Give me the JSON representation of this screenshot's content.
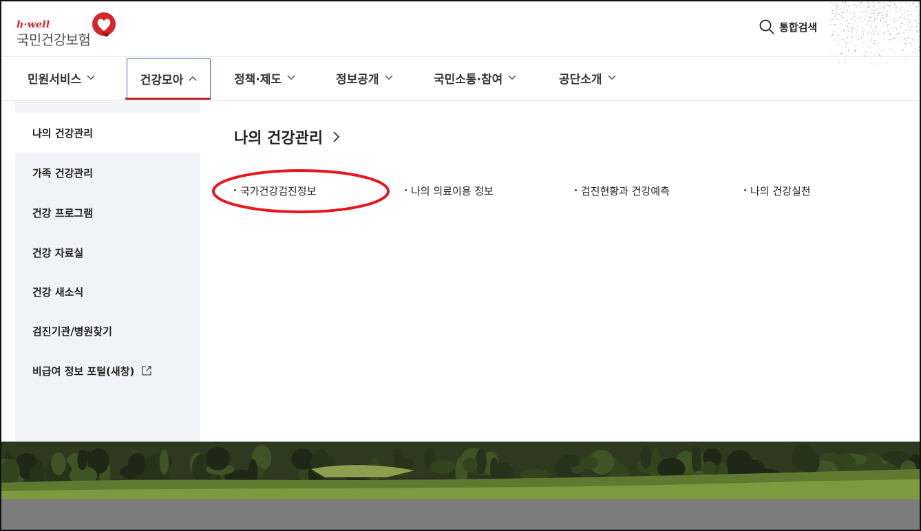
{
  "header": {
    "logo_brand": "h·well",
    "logo_name": "국민건강보험",
    "search_label": "통합검색"
  },
  "gnb": {
    "items": [
      {
        "label": "민원서비스",
        "expanded": false
      },
      {
        "label": "건강모아",
        "expanded": true
      },
      {
        "label": "정책·제도",
        "expanded": false
      },
      {
        "label": "정보공개",
        "expanded": false
      },
      {
        "label": "국민소통·참여",
        "expanded": false
      },
      {
        "label": "공단소개",
        "expanded": false
      }
    ]
  },
  "sidebar": {
    "items": [
      {
        "label": "나의 건강관리",
        "active": true
      },
      {
        "label": "가족 건강관리",
        "active": false
      },
      {
        "label": "건강 프로그램",
        "active": false
      },
      {
        "label": "건강 자료실",
        "active": false
      },
      {
        "label": "건강 새소식",
        "active": false
      },
      {
        "label": "검진기관/병원찾기",
        "active": false
      },
      {
        "label": "비급여 정보 포털(새창)",
        "active": false,
        "external": true
      }
    ]
  },
  "content": {
    "title": "나의 건강관리",
    "links": [
      {
        "label": "국가건강검진정보",
        "highlighted": true
      },
      {
        "label": "나의 의료이용 정보"
      },
      {
        "label": "검진현황과 건강예측"
      },
      {
        "label": "나의 건강실천"
      }
    ]
  },
  "colors": {
    "brand_red": "#d4262d",
    "active_underline": "#b5272d",
    "active_border": "#3d6ea8",
    "sidebar_bg": "#f2f3f8",
    "annotation_red": "#e8161c"
  },
  "icons": {
    "search": "search-icon",
    "chevron_down": "chevron-down-icon",
    "chevron_up": "chevron-up-icon",
    "chevron_right": "chevron-right-icon",
    "external_link": "external-link-icon",
    "logo_heart": "heart-logo-icon"
  }
}
